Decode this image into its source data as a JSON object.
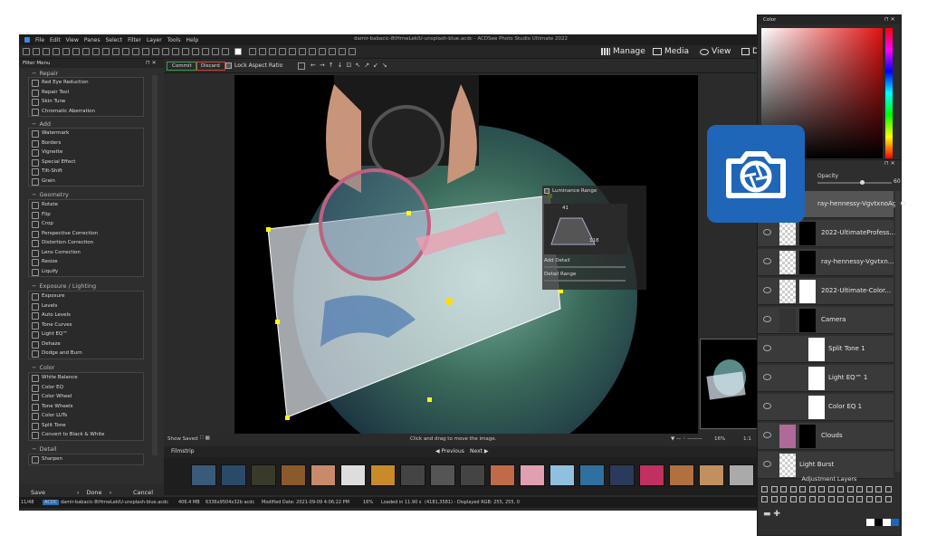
{
  "window": {
    "title": "damir-babacic-8tHmwLekIU-unsplash-blue.acdc - ACDSee Photo Studio Ultimate 2022"
  },
  "menu": [
    "File",
    "Edit",
    "View",
    "Panes",
    "Select",
    "Filter",
    "Layer",
    "Tools",
    "Help"
  ],
  "modes": [
    {
      "label": "Manage",
      "icon": "grid-icon"
    },
    {
      "label": "Media",
      "icon": "media-icon"
    },
    {
      "label": "View",
      "icon": "eye-icon"
    },
    {
      "label": "D",
      "icon": "develop-icon"
    }
  ],
  "optionsbar": {
    "commit": "Commit",
    "discard": "Discard",
    "lock_aspect": "Lock Aspect Ratio",
    "lock_checked": true
  },
  "filter_menu": {
    "title": "Filter Menu",
    "sections": [
      {
        "name": "Repair",
        "items": [
          "Red Eye Reduction",
          "Repair Tool",
          "Skin Tune",
          "Chromatic Aberration"
        ]
      },
      {
        "name": "Add",
        "items": [
          "Watermark",
          "Borders",
          "Vignette",
          "Special Effect",
          "Tilt-Shift",
          "Grain"
        ]
      },
      {
        "name": "Geometry",
        "items": [
          "Rotate",
          "Flip",
          "Crop",
          "Perspective Correction",
          "Distortion Correction",
          "Lens Correction",
          "Resize",
          "Liquify"
        ]
      },
      {
        "name": "Exposure / Lighting",
        "items": [
          "Exposure",
          "Levels",
          "Auto Levels",
          "Tone Curves",
          "Light EQ™",
          "Dehaze",
          "Dodge and Burn"
        ]
      },
      {
        "name": "Color",
        "items": [
          "White Balance",
          "Color EQ",
          "Color Wheel",
          "Tone Wheels",
          "Color LUTs",
          "Split Tone",
          "Convert to Black & White"
        ]
      },
      {
        "name": "Detail",
        "items": [
          "Sharpen"
        ]
      }
    ],
    "buttons": {
      "save": "Save",
      "done": "Done",
      "cancel": "Cancel"
    }
  },
  "luminance": {
    "label": "Luminance Range",
    "v1": "41",
    "v2": "118",
    "add_detail": "Add Detail",
    "detail_range": "Detail Range"
  },
  "canvasbar": {
    "show_saved": "Show Saved",
    "hint": "Click and drag to move the image.",
    "zoom": "16%",
    "ratio": "1:1"
  },
  "filmstrip": {
    "title": "Filmstrip",
    "previous": "Previous",
    "next": "Next",
    "thumb_colors": [
      "#3a5a7a",
      "#2a4a6a",
      "#3a3a2a",
      "#8a5a2a",
      "#c88a6a",
      "#ddd",
      "#c88a2a",
      "#444",
      "#555",
      "#444",
      "#c06a4a",
      "#e0a0b0",
      "#90c0e0",
      "#3070a0",
      "#2a3a5a",
      "#c03060",
      "#b07040",
      "#c09060",
      "#aaa"
    ]
  },
  "statusbar": {
    "index": "11/48",
    "format": "ACDC",
    "filename": "damir-babacic-8tHmwLekIU-unsplash-blue.acdc",
    "size": "406.4 MB",
    "dims": "6336x9504x32b acdc",
    "modified": "Modified Date: 2021-09-09 4:06:22 PM",
    "zoom": "16%",
    "loaded": "Loaded in 11.90 s",
    "pixel": "(4181,3581) - Displayed RGB: 255, 255, 0"
  },
  "color_panel": {
    "title": "Color"
  },
  "layers": {
    "opacity_label": "Opacity",
    "opacity_value": "60",
    "opacity_fraction": 0.6,
    "rows": [
      {
        "name": "ray-hennessy-VgvtxnoAg4Q-..."
      },
      {
        "name": "2022-UltimateProfess..."
      },
      {
        "name": "ray-hennessy-Vgvtxn..."
      },
      {
        "name": "2022-Ultimate-Color..."
      },
      {
        "name": "Camera"
      },
      {
        "name": "Split Tone 1"
      },
      {
        "name": "Light EQ™ 1"
      },
      {
        "name": "Color EQ 1"
      },
      {
        "name": "Clouds"
      },
      {
        "name": "Light Burst"
      }
    ],
    "adjustment_title": "Adjustment Layers"
  },
  "colors": {
    "accent_blue": "#1f66b8",
    "commit_green": "#3aa057",
    "discard_red": "#c24a3a"
  }
}
